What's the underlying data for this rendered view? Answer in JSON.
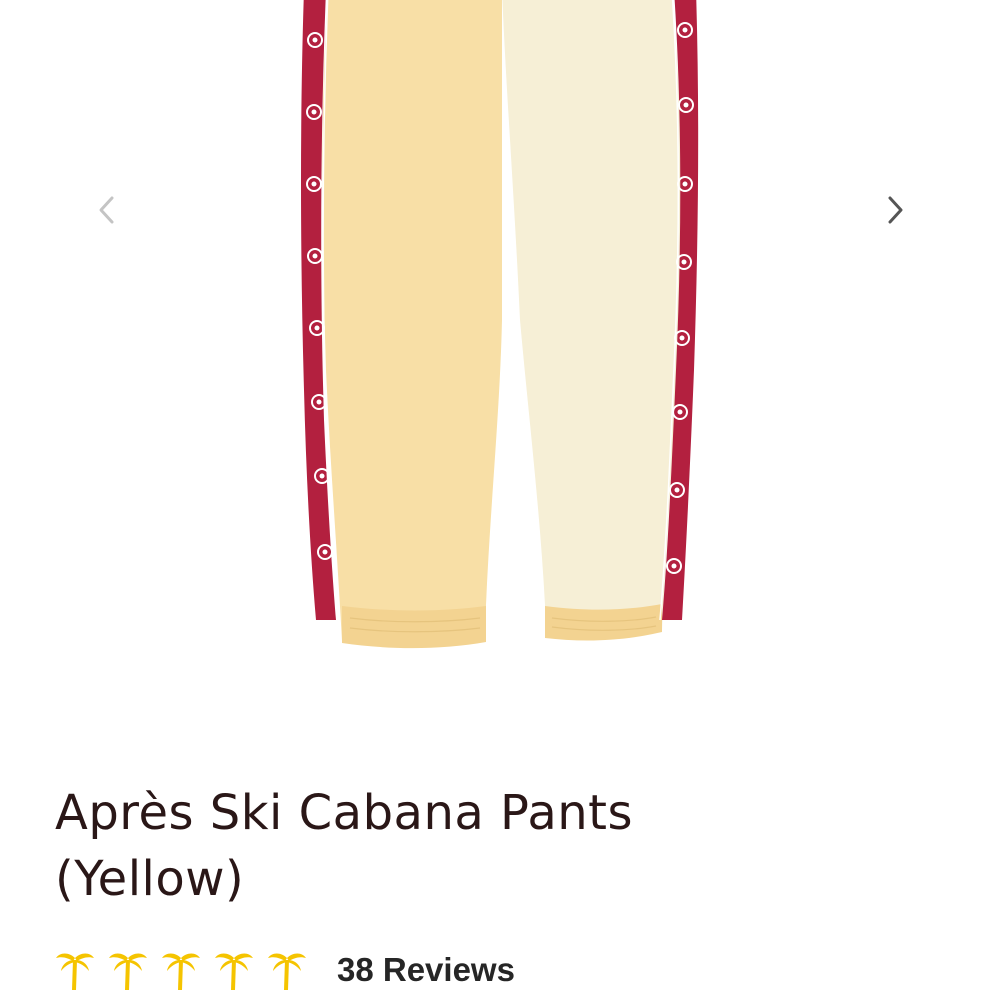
{
  "product": {
    "title_line1": "Après Ski Cabana Pants",
    "title_line2": "(Yellow)",
    "image_icon": "cabana-pants-image",
    "colors": {
      "left_leg": "#f8dfa6",
      "right_leg": "#f6efd6",
      "stripe": "#b3203f",
      "title": "#2a1717",
      "star": "#f5c400"
    }
  },
  "gallery": {
    "prev_icon": "chevron-left-icon",
    "next_icon": "chevron-right-icon"
  },
  "rating": {
    "stars": 5,
    "max_stars": 5,
    "star_icon": "palm-tree-icon",
    "reviews_label": "38 Reviews"
  }
}
